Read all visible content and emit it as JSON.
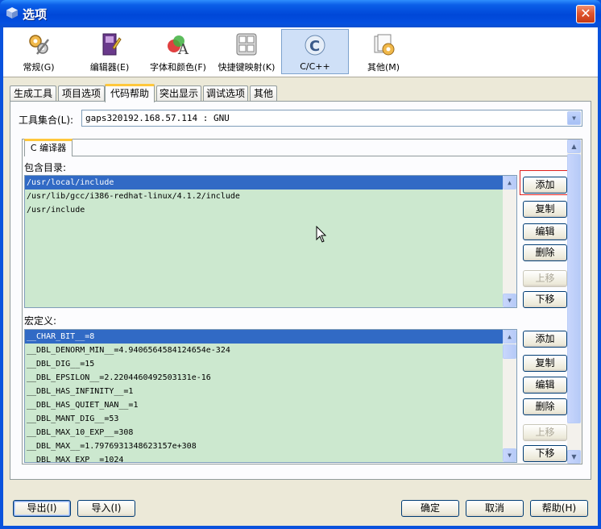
{
  "window": {
    "title": "选项",
    "close_glyph": "✕"
  },
  "categories": [
    {
      "label": "常规(G)",
      "icon": "gears-icon"
    },
    {
      "label": "编辑器(E)",
      "icon": "editor-book-icon"
    },
    {
      "label": "字体和颜色(F)",
      "icon": "font-color-icon"
    },
    {
      "label": "快捷键映射(K)",
      "icon": "keyboard-icon"
    },
    {
      "label": "C/C++",
      "icon": "c-cpp-icon",
      "selected": true
    },
    {
      "label": "其他(M)",
      "icon": "misc-icon"
    }
  ],
  "tabs": [
    "生成工具",
    "项目选项",
    "代码帮助",
    "突出显示",
    "调试选项",
    "其他"
  ],
  "active_tab": "代码帮助",
  "toolset": {
    "label": "工具集合(L):",
    "value": "gaps320192.168.57.114 : GNU"
  },
  "inner_tab": "C 编译器",
  "include": {
    "label": "包含目录:",
    "items": [
      "/usr/local/include",
      "/usr/lib/gcc/i386-redhat-linux/4.1.2/include",
      "/usr/include"
    ],
    "buttons": [
      "添加",
      "复制",
      "编辑",
      "删除",
      "上移",
      "下移"
    ]
  },
  "macros": {
    "label": "宏定义:",
    "items": [
      "__CHAR_BIT__=8",
      "__DBL_DENORM_MIN__=4.9406564584124654e-324",
      "__DBL_DIG__=15",
      "__DBL_EPSILON__=2.2204460492503131e-16",
      "__DBL_HAS_INFINITY__=1",
      "__DBL_HAS_QUIET_NAN__=1",
      "__DBL_MANT_DIG__=53",
      "__DBL_MAX_10_EXP__=308",
      "__DBL_MAX__=1.7976931348623157e+308",
      "__DBL_MAX_EXP__=1024"
    ],
    "buttons": [
      "添加",
      "复制",
      "编辑",
      "删除",
      "上移",
      "下移"
    ]
  },
  "footer": {
    "export": "导出(I)",
    "import": "导入(I)",
    "ok": "确定",
    "cancel": "取消",
    "help": "帮助(H)"
  },
  "colors": {
    "accent": "#316ac5",
    "list_bg": "#cce8cf",
    "titlebar": "#0a52dd"
  }
}
